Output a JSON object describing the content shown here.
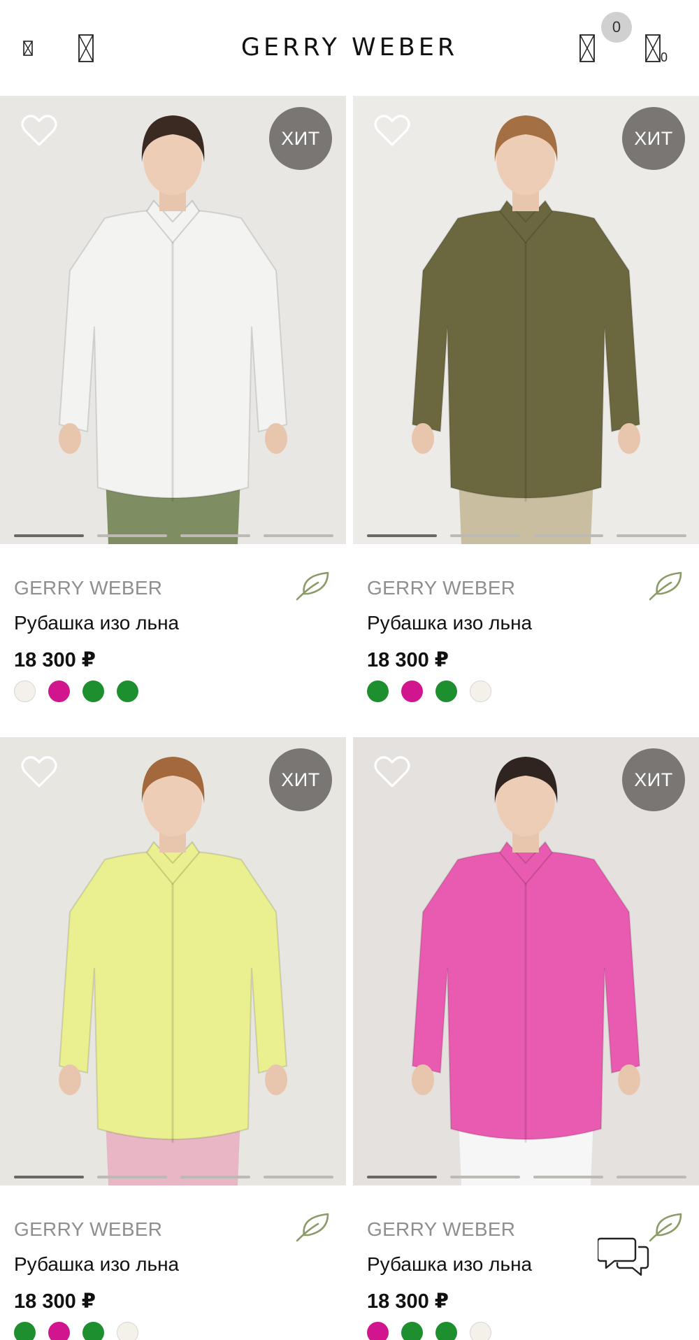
{
  "header": {
    "logo": "GERRY WEBER",
    "cart_count": "0",
    "icons": [
      "menu-icon",
      "search-icon",
      "wishlist-icon",
      "cart-icon"
    ]
  },
  "products": [
    {
      "brand": "GERRY WEBER",
      "title": "Рубашка изо льна",
      "price": "18 300 ₽",
      "badge": "ХИТ",
      "image_bg": "#e9e7e4",
      "shirt_color": "#f3f3f1",
      "bottom_color": "#7e8d62",
      "active_slide": 0,
      "swatches": [
        "#f4f1ea",
        "#d1158f",
        "#1e8f2e",
        "#1e8f2e"
      ]
    },
    {
      "brand": "GERRY WEBER",
      "title": "Рубашка изо льна",
      "price": "18 300 ₽",
      "badge": "ХИТ",
      "image_bg": "#ecebe7",
      "shirt_color": "#6b6840",
      "bottom_color": "#c9bfa0",
      "active_slide": 0,
      "swatches": [
        "#1e8f2e",
        "#d1158f",
        "#1e8f2e",
        "#f4f1ea"
      ]
    },
    {
      "brand": "GERRY WEBER",
      "title": "Рубашка изо льна",
      "price": "18 300 ₽",
      "badge": "ХИТ",
      "image_bg": "#e8e6e1",
      "shirt_color": "#eaef8f",
      "bottom_color": "#e8b6c4",
      "active_slide": 0,
      "swatches": [
        "#1e8f2e",
        "#d1158f",
        "#1e8f2e",
        "#f4f1ea"
      ]
    },
    {
      "brand": "GERRY WEBER",
      "title": "Рубашка изо льна",
      "price": "18 300 ₽",
      "badge": "ХИТ",
      "image_bg": "#e4e1de",
      "shirt_color": "#e95bb0",
      "bottom_color": "#f6f6f6",
      "active_slide": 0,
      "swatches": [
        "#d1158f",
        "#1e8f2e",
        "#1e8f2e",
        "#f4f1ea"
      ]
    }
  ],
  "chat_icon": "chat-icon",
  "eco_icon": "leaf-icon"
}
